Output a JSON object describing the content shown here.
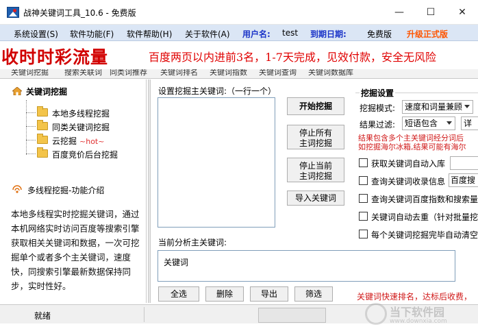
{
  "window": {
    "title": "战神关键词工具_10.6 - 免费版",
    "min_symbol": "—",
    "max_symbol": "☐",
    "close_symbol": "✕"
  },
  "menu": {
    "items": [
      "系统设置(S)",
      "软件功能(F)",
      "软件帮助(H)",
      "关于软件(A)"
    ],
    "username_label": "用户名:",
    "username_value": "test",
    "expire_label": "到期日期:",
    "expire_value": "免费版",
    "upgrade": "升级正式版"
  },
  "banner": {
    "bold_text": "收时时彩流量",
    "scroll_text": "百度两页以内进前3名，1-7天完成，见效付款，安全无风险"
  },
  "tabs": [
    "关键词挖掘",
    "搜索关联词",
    "同类词推荐",
    "关键词排名",
    "关键词指数",
    "关键词查询",
    "关键词数据库"
  ],
  "left": {
    "tree_title": "关键词挖掘",
    "tree_items": [
      {
        "label": "本地多线程挖掘",
        "hot": ""
      },
      {
        "label": "同类关键词挖掘",
        "hot": ""
      },
      {
        "label": "云挖掘",
        "hot": "~hot~"
      },
      {
        "label": "百度竞价后台挖掘",
        "hot": ""
      }
    ],
    "intro_title": "多线程挖掘-功能介绍",
    "intro_text": "本地多线程实时挖掘关键词，通过本机网络实时访问百度等搜索引擎获取相关关键词和数据，一次可挖掘单个或者多个主关键词，速度快，同搜索引擎最新数据保持同步，实时性好。"
  },
  "center": {
    "keywords_label": "设置挖掘主关键词:（一行一个）",
    "start_button": "开始挖掘",
    "stop_all_button": [
      "停止所有",
      "主词挖掘"
    ],
    "stop_current_button": [
      "停止当前",
      "主词挖掘"
    ],
    "import_button": "导入关键词",
    "current_label": "当前分析主关键词:",
    "current_column": "关键词",
    "bottom_buttons": [
      "全选",
      "删除",
      "导出",
      "筛选"
    ]
  },
  "settings": {
    "title": "挖掘设置",
    "mode_label": "挖掘模式:",
    "mode_value": "速度和词量兼顾",
    "filter_label": "结果过滤:",
    "filter_value": "短语包含",
    "filter_extra": "详",
    "red_note_lines": [
      "结果包含多个主关键词经分词后",
      "如挖掘海尔冰箱,结果可能有海尔"
    ],
    "checkboxes": [
      {
        "label": "获取关键词自动入库",
        "checked": false
      },
      {
        "label": "查询关键词收录信息",
        "checked": false
      },
      {
        "label": "查询关键词百度指数和搜索量",
        "checked": false
      },
      {
        "label": "关键词自动去重（针对批量挖",
        "checked": false
      },
      {
        "label": "每个关键词挖掘完毕自动清空",
        "checked": false
      }
    ],
    "baidu_select": "百度搜",
    "bottom_red": "关键词快速排名，达标后收费，"
  },
  "status": {
    "text": "就绪"
  },
  "watermark": {
    "text": "当下软件园",
    "url": "www.downxia.com"
  },
  "colors": {
    "menubar_bg": "#dbe6f5",
    "menu_blue": "#1a33c8",
    "menu_orange": "#ff5500",
    "banner_red": "#d10000",
    "note_red": "#d01818"
  }
}
